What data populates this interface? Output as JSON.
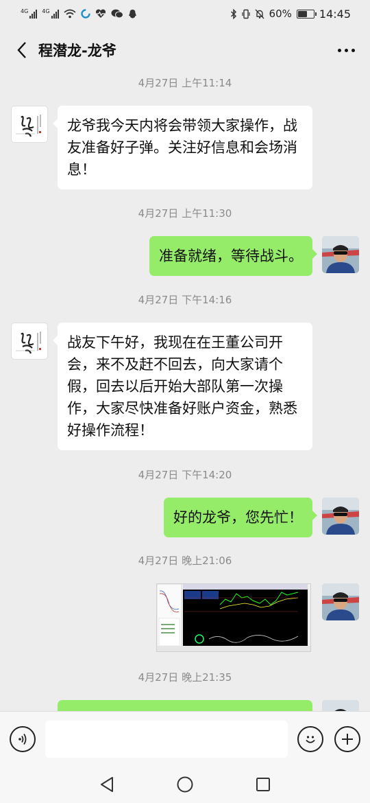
{
  "status_bar": {
    "network1": "4G",
    "network2": "4G",
    "battery_text": "60%",
    "battery_level": 0.6,
    "time": "14:45"
  },
  "header": {
    "title": "程潜龙-龙爷"
  },
  "messages": [
    {
      "type": "timestamp",
      "text": "4月27日 上午11:14"
    },
    {
      "type": "text",
      "side": "left",
      "text": "龙爷我今天内将会带领大家操作，战友准备好子弹。关注好信息和会场消息！"
    },
    {
      "type": "timestamp",
      "text": "4月27日 上午11:30"
    },
    {
      "type": "text",
      "side": "right",
      "text": "准备就绪，等待战斗。"
    },
    {
      "type": "timestamp",
      "text": "4月27日 下午14:16"
    },
    {
      "type": "text",
      "side": "left",
      "text": "战友下午好，我现在在王董公司开会，来不及赶不回去，向大家请个假，回去以后开始大部队第一次操作，大家尽快准备好账户资金，熟悉好操作流程！"
    },
    {
      "type": "timestamp",
      "text": "4月27日 下午14:20"
    },
    {
      "type": "text",
      "side": "right",
      "text": "好的龙爷，您先忙！"
    },
    {
      "type": "timestamp",
      "text": "4月27日 晚上21:06"
    },
    {
      "type": "image",
      "side": "right"
    },
    {
      "type": "timestamp",
      "text": "4月27日 晚上21:35"
    },
    {
      "type": "text",
      "side": "right",
      "text": ""
    }
  ],
  "colors": {
    "background": "#ededed",
    "bubble_self": "#95ec69",
    "bubble_other": "#ffffff"
  },
  "icons": [
    "signal-icon",
    "wifi-icon",
    "heart-rate-icon",
    "wechat-icon",
    "qq-icon",
    "bluetooth-icon",
    "vibrate-icon",
    "mute-icon",
    "battery-icon",
    "back-icon",
    "more-icon",
    "voice-icon",
    "emoji-icon",
    "plus-icon",
    "nav-back-icon",
    "nav-home-icon",
    "nav-recents-icon"
  ]
}
